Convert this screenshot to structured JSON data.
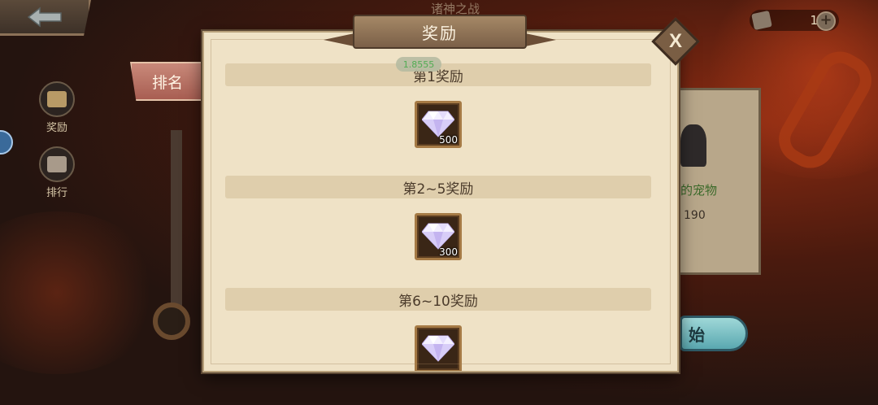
{
  "top_bar": {
    "title": "诸神之战",
    "currency_value": "1"
  },
  "side_menu": [
    {
      "label": "奖励"
    },
    {
      "label": "排行"
    }
  ],
  "tab": {
    "label": "排名"
  },
  "right_card": {
    "line1": "的宠物",
    "line2": "190"
  },
  "start_button": {
    "label": "始"
  },
  "panel": {
    "title": "奖励",
    "close_label": "X",
    "badge": "1.8555"
  },
  "rewards": [
    {
      "title": "第1奖励",
      "item": {
        "icon": "diamond-icon",
        "qty": "500"
      }
    },
    {
      "title": "第2~5奖励",
      "item": {
        "icon": "diamond-icon",
        "qty": "300"
      }
    },
    {
      "title": "第6~10奖励",
      "item": {
        "icon": "diamond-icon",
        "qty": ""
      }
    }
  ],
  "colors": {
    "panel_bg": "#efe2c6",
    "tier_bar": "#dfceac",
    "badge_text": "#43a84a"
  }
}
